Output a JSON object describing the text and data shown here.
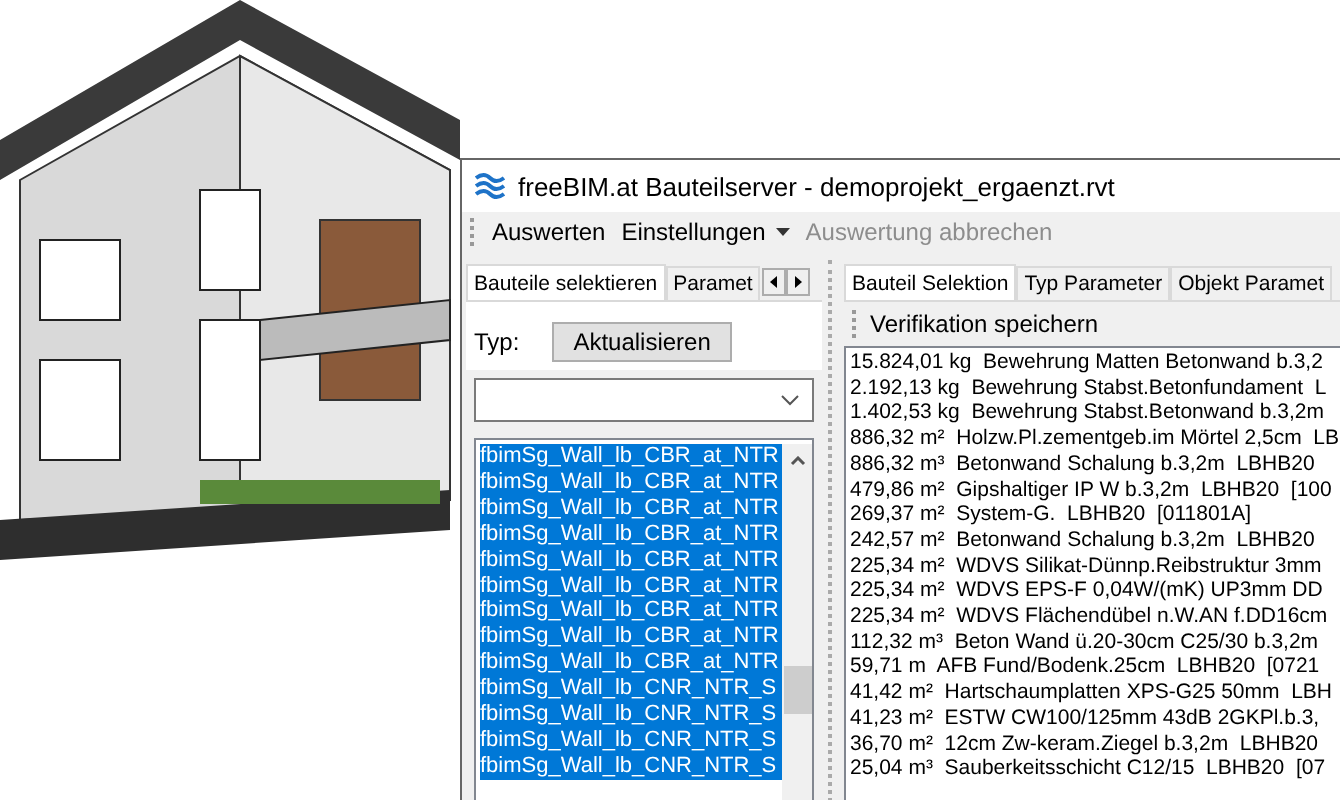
{
  "window": {
    "title": "freeBIM.at Bauteilserver - demoprojekt_ergaenzt.rvt"
  },
  "toolbar": [
    {
      "label": "Auswerten",
      "kind": "plain",
      "disabled": false
    },
    {
      "label": "Einstellungen",
      "kind": "dropdown",
      "disabled": false
    },
    {
      "label": "Auswertung abbrechen",
      "kind": "plain",
      "disabled": true
    }
  ],
  "left_panel": {
    "tabs": [
      {
        "label": "Bauteile selektieren",
        "selected": true
      },
      {
        "label": "Paramet",
        "selected": false
      }
    ],
    "type_label": "Typ:",
    "refresh_button": "Aktualisieren",
    "items": [
      {
        "label": "fbimSg_Wall_lb_CBR_at_NTR",
        "selected": true
      },
      {
        "label": "fbimSg_Wall_lb_CBR_at_NTR",
        "selected": true
      },
      {
        "label": "fbimSg_Wall_lb_CBR_at_NTR",
        "selected": true
      },
      {
        "label": "fbimSg_Wall_lb_CBR_at_NTR",
        "selected": true
      },
      {
        "label": "fbimSg_Wall_lb_CBR_at_NTR",
        "selected": true
      },
      {
        "label": "fbimSg_Wall_lb_CBR_at_NTR",
        "selected": true
      },
      {
        "label": "fbimSg_Wall_lb_CBR_at_NTR",
        "selected": true
      },
      {
        "label": "fbimSg_Wall_lb_CBR_at_NTR",
        "selected": true
      },
      {
        "label": "fbimSg_Wall_lb_CBR_at_NTR",
        "selected": true
      },
      {
        "label": "fbimSg_Wall_lb_CNR_NTR_S",
        "selected": true
      },
      {
        "label": "fbimSg_Wall_lb_CNR_NTR_S",
        "selected": true
      },
      {
        "label": "fbimSg_Wall_lb_CNR_NTR_S",
        "selected": true
      },
      {
        "label": "fbimSg_Wall_lb_CNR_NTR_S",
        "selected": true
      }
    ]
  },
  "right_panel": {
    "tabs": [
      {
        "label": "Bauteil Selektion",
        "selected": true
      },
      {
        "label": "Typ Parameter",
        "selected": false
      },
      {
        "label": "Objekt Paramet",
        "selected": false
      }
    ],
    "save_button": "Verifikation speichern",
    "rows": [
      "15.824,01 kg  Bewehrung Matten Betonwand b.3,2",
      "2.192,13 kg  Bewehrung Stabst.Betonfundament  L",
      "1.402,53 kg  Bewehrung Stabst.Betonwand b.3,2m",
      "886,32 m²  Holzw.Pl.zementgeb.im Mörtel 2,5cm  LB",
      "886,32 m³  Betonwand Schalung b.3,2m  LBHB20",
      "479,86 m²  Gipshaltiger IP W b.3,2m  LBHB20  [100",
      "269,37 m²  System-G.  LBHB20  [011801A]",
      "242,57 m²  Betonwand Schalung b.3,2m  LBHB20",
      "225,34 m²  WDVS Silikat-Dünnp.Reibstruktur 3mm",
      "225,34 m²  WDVS EPS-F 0,04W/(mK) UP3mm DD",
      "225,34 m²  WDVS Flächendübel n.W.AN f.DD16cm",
      "112,32 m³  Beton Wand ü.20-30cm C25/30 b.3,2m",
      "59,71 m  AFB Fund/Bodenk.25cm  LBHB20  [0721",
      "41,42 m²  Hartschaumplatten XPS-G25 50mm  LBH",
      "41,23 m²  ESTW CW100/125mm 43dB 2GKPl.b.3,",
      "36,70 m²  12cm Zw-keram.Ziegel b.3,2m  LBHB20",
      "25,04 m³  Sauberkeitsschicht C12/15  LBHB20  [07"
    ]
  }
}
